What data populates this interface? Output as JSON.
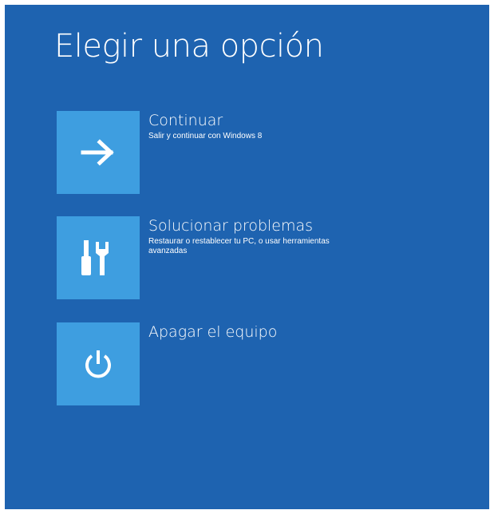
{
  "page": {
    "title": "Elegir una opción",
    "background_color": "#1e63b0",
    "tile_color": "#3e9ee0"
  },
  "options": [
    {
      "title": "Continuar",
      "description": "Salir y continuar  con Windows 8",
      "icon": "arrow-right-icon"
    },
    {
      "title": "Solucionar problemas",
      "description": "Restaurar o restablecer tu PC, o usar herramientas avanzadas",
      "icon": "tools-icon"
    },
    {
      "title": "Apagar el equipo",
      "description": "",
      "icon": "power-icon"
    }
  ]
}
